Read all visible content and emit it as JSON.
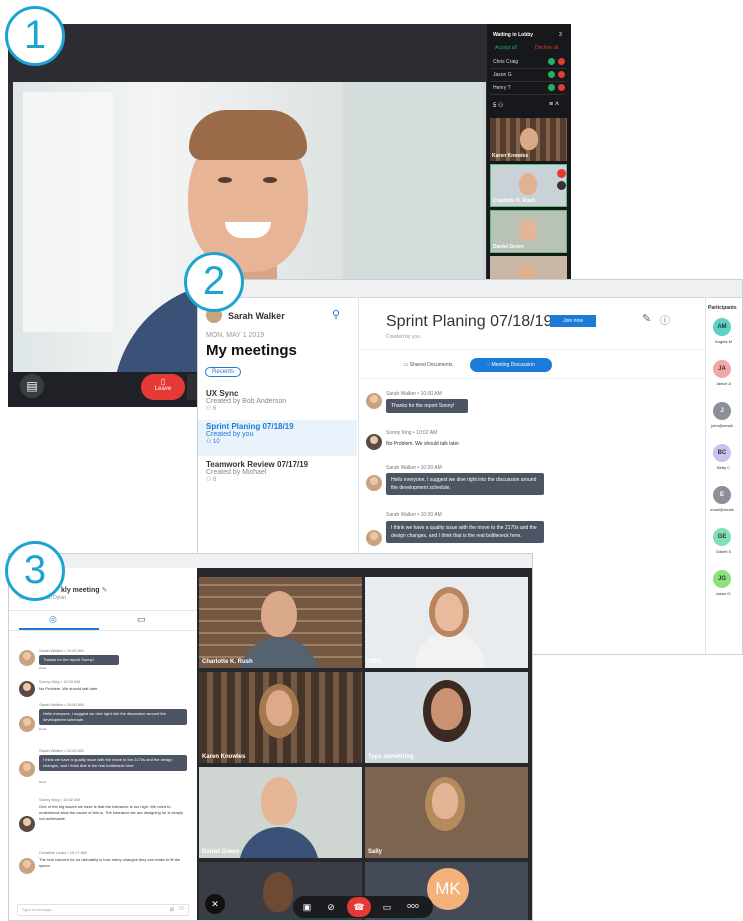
{
  "badges": [
    "1",
    "2",
    "3"
  ],
  "screen1": {
    "lobby": {
      "title": "Waiting in Lobby",
      "count": "3",
      "accept_all": "Accept all",
      "decline_all": "Decline all",
      "people": [
        "Chris Craig",
        "Jason G",
        "Henry T"
      ]
    },
    "participants_count": "5",
    "thumbnails": [
      "Karen Knowles",
      "Charlotte K. Rush",
      "Daniel Green"
    ],
    "leave_label": "Leave",
    "colors": {
      "accept": "#27ae60",
      "decline": "#e53935",
      "accent": "#1ba4d1"
    }
  },
  "screen2": {
    "user_name": "Sarah Walker",
    "date": "MON, MAY 1 2019",
    "heading": "My meetings",
    "recents": "Recents",
    "meetings": [
      {
        "title": "UX Sync",
        "by": "Created by Bob Anderson",
        "count": "6"
      },
      {
        "title": "Sprint Planing 07/18/19",
        "by": "Created by you",
        "count": "10"
      },
      {
        "title": "Teamwork Review 07/17/19",
        "by": "Created by Michael",
        "count": "6"
      }
    ],
    "meeting_title": "Sprint Planing 07/18/19",
    "join_now": "Join now",
    "created_by": "Created by you",
    "tab_docs": "Shared Documents",
    "tab_discussion": "Meeting Discussion",
    "messages": [
      {
        "name": "Sarah Walker • 10:00 AM",
        "text": "Thanks for the report Sonny!"
      },
      {
        "name": "Sonny King • 10:02 AM",
        "text": "No Problem. We should talk later"
      },
      {
        "name": "Sarah Walker • 10:00 AM",
        "text": "Hello everyone, I suggest we dive right into the discussion around the development schedule."
      },
      {
        "name": "Sarah Walker • 10:00 AM",
        "text": "I think we have a quality issue with the move to the 2170s and the design changes, and I think that is the real bottleneck here."
      }
    ],
    "participants_title": "Participants",
    "participants": [
      {
        "initials": "AM",
        "name": "Angela M",
        "color": "#5ed1c2"
      },
      {
        "initials": "JA",
        "name": "Janice A",
        "color": "#f3a6a6"
      },
      {
        "initials": "J",
        "name": "john@email...",
        "color": "#8a8f99"
      },
      {
        "initials": "BC",
        "name": "Betty C",
        "color": "#c9c3f0"
      },
      {
        "initials": "E",
        "name": "email@email...",
        "color": "#8a8f99"
      },
      {
        "initials": "GE",
        "name": "Gilbert E",
        "color": "#7fe0b8"
      },
      {
        "initials": "JG",
        "name": "Jason G.",
        "color": "#8fe07f"
      }
    ]
  },
  "screen3": {
    "title": "kly meeting",
    "host": "Hosted by Bob Dylan",
    "messages": [
      {
        "name": "Sarah Walker • 10:00 AM",
        "text": "Thanks for the report Sonny!",
        "bubble": true
      },
      {
        "name": "Sonny King • 10:02 AM",
        "text": "No Problem. We should talk later",
        "bubble": false
      },
      {
        "name": "Sarah Walker • 10:00 AM",
        "text": "Hello everyone, I suggest we dive right into the discussion around the development schedule.",
        "bubble": true
      },
      {
        "name": "Sarah Walker • 10:00 AM",
        "text": "I think we have a quality issue with the move to the 2170s and the design changes, and I think that is the real bottleneck here.",
        "bubble": true
      },
      {
        "name": "Sonny King • 10:02 AM",
        "text": "One of the big issues we have is that the tolerance is too high. We need to understand what the cause of this is. The tolerance we are designing for is simply not achievable.",
        "bubble": false
      },
      {
        "name": "Christine Lewis • 10:17 AM",
        "text": "The real concern for us ultimately is how many changes they can make to fit the specs.",
        "bubble": false
      }
    ],
    "read": "Read",
    "input_placeholder": "Type a message...",
    "tiles": [
      {
        "name": "Charlotte K. Rush"
      },
      {
        "name": "YOU"
      },
      {
        "name": "Karen Knowles"
      },
      {
        "name": "Type something"
      },
      {
        "name": "Daniel Green"
      },
      {
        "name": "Sally"
      },
      {
        "name": ""
      },
      {
        "name": ""
      }
    ],
    "mk_initials": "MK"
  }
}
